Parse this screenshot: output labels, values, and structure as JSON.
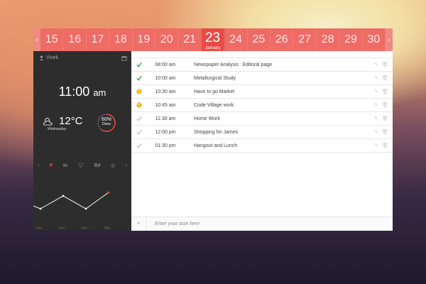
{
  "date_strip": {
    "dates": [
      "15",
      "16",
      "17",
      "18",
      "19",
      "20",
      "21",
      "23",
      "24",
      "25",
      "26",
      "27",
      "28",
      "29",
      "30"
    ],
    "active_index": 7,
    "active_month": "January",
    "prev_icon": "chevron-left-icon",
    "next_icon": "chevron-right-icon"
  },
  "sidebar": {
    "user_name": "Vivek",
    "time": "11:00",
    "ampm": "am",
    "temperature": "12",
    "degree_unit": "°C",
    "weekday": "Wednesday",
    "progress_value": "60%",
    "progress_label": "Done",
    "progress_fraction": 0.6,
    "social_icons": [
      "pinterest-icon",
      "linkedin-icon",
      "twitter-icon",
      "behance-icon",
      "dribbble-icon"
    ],
    "chart_labels": [
      "20",
      "21",
      "22",
      "23"
    ],
    "chart_label_suffix": "jan"
  },
  "tasks": [
    {
      "status": "done",
      "time": "08:00 am",
      "title": "Newspaper Analysis : Editoral page"
    },
    {
      "status": "done",
      "time": "10:00 am",
      "title": "Metallurgical Study"
    },
    {
      "status": "warning",
      "time": "10:30 am",
      "title": "Have to go Market"
    },
    {
      "status": "warning",
      "time": "10:45 am",
      "title": "Code Village work"
    },
    {
      "status": "pending",
      "time": "11:30 am",
      "title": "Home Work"
    },
    {
      "status": "pending",
      "time": "12:00 pm",
      "title": "Shopping for James"
    },
    {
      "status": "pending",
      "time": "01:30 pm",
      "title": "Hangout and Lunch"
    }
  ],
  "add_task": {
    "placeholder": "Enter your task here",
    "icon": "plus-icon"
  },
  "colors": {
    "accent": "#ee6b66",
    "done": "#3aa64a",
    "warning": "#f0b400",
    "pending": "#c4c4c4"
  }
}
